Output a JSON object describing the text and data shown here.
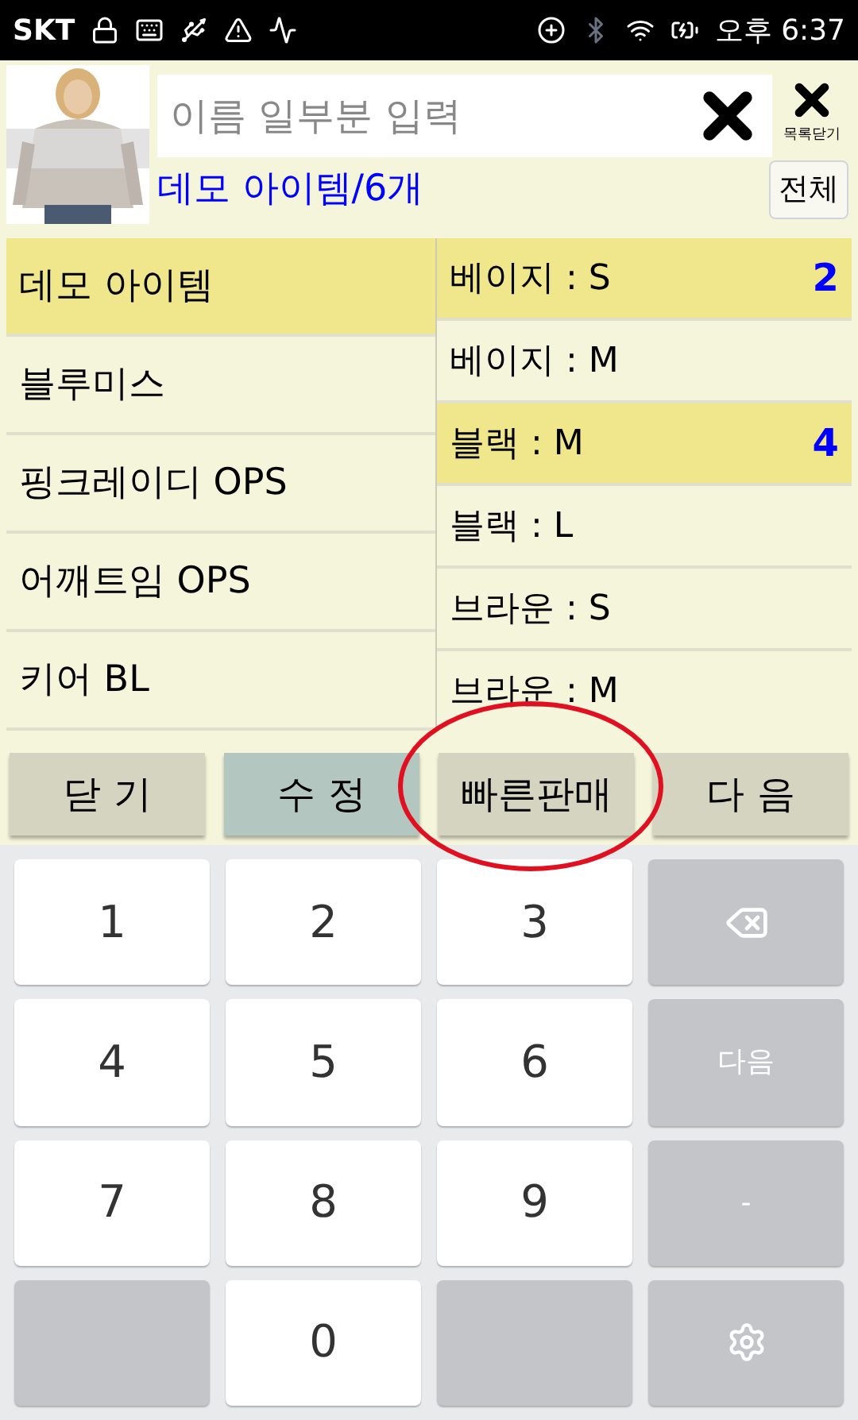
{
  "status_bar": {
    "carrier": "SKT",
    "time": "오후 6:37"
  },
  "header": {
    "search": {
      "placeholder": "이름 일부분 입력"
    },
    "close_list": {
      "label": "목록닫기"
    },
    "title": "데모 아이템/6개",
    "all_button": "전체"
  },
  "items": [
    {
      "name": "데모 아이템",
      "selected": true
    },
    {
      "name": "블루미스",
      "selected": false
    },
    {
      "name": "핑크레이디 OPS",
      "selected": false
    },
    {
      "name": "어깨트임 OPS",
      "selected": false
    },
    {
      "name": "키어 BL",
      "selected": false
    }
  ],
  "options": [
    {
      "name": "베이지 : S",
      "qty": "2",
      "selected": true
    },
    {
      "name": "베이지 : M",
      "selected": false
    },
    {
      "name": "블랙 : M",
      "qty": "4",
      "selected": true
    },
    {
      "name": "블랙 : L",
      "selected": false
    },
    {
      "name": "브라운 : S",
      "selected": false
    },
    {
      "name": "브라운 : M",
      "selected": false
    }
  ],
  "actions": [
    {
      "label": "닫 기",
      "kind": "plain"
    },
    {
      "label": "수 정",
      "kind": "accent"
    },
    {
      "label": "빠른판매",
      "kind": "plain"
    },
    {
      "label": "다 음",
      "kind": "plain"
    }
  ],
  "keypad": [
    {
      "kind": "key",
      "label": "1"
    },
    {
      "kind": "key",
      "label": "2"
    },
    {
      "kind": "key",
      "label": "3"
    },
    {
      "kind": "backspace"
    },
    {
      "kind": "key",
      "label": "4"
    },
    {
      "kind": "key",
      "label": "5"
    },
    {
      "kind": "key",
      "label": "6"
    },
    {
      "kind": "function",
      "label": "다음"
    },
    {
      "kind": "key",
      "label": "7"
    },
    {
      "kind": "key",
      "label": "8"
    },
    {
      "kind": "key",
      "label": "9"
    },
    {
      "kind": "function",
      "label": "-"
    },
    {
      "kind": "function"
    },
    {
      "kind": "key",
      "label": "0"
    },
    {
      "kind": "function"
    },
    {
      "kind": "settings"
    }
  ]
}
